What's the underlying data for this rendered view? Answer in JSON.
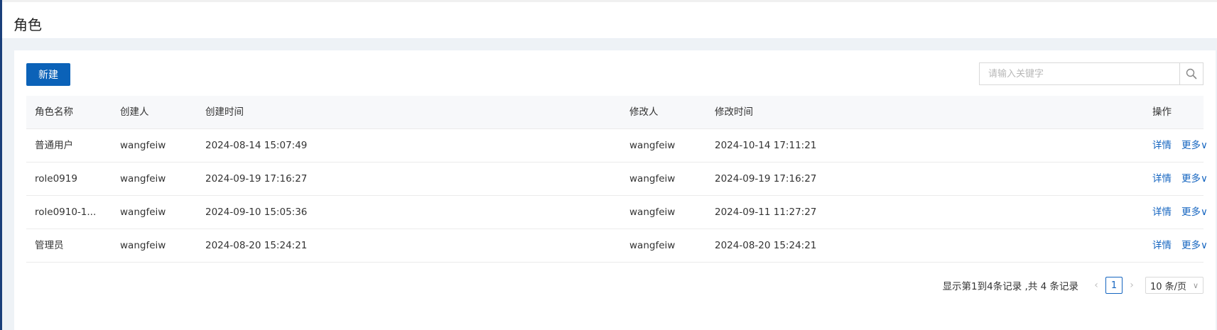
{
  "page": {
    "title": "角色"
  },
  "toolbar": {
    "new_label": "新建"
  },
  "search": {
    "placeholder": "请输入关键字",
    "icon": "search-icon"
  },
  "table": {
    "headers": {
      "name": "角色名称",
      "creator": "创建人",
      "created_at": "创建时间",
      "modifier": "修改人",
      "modified_at": "修改时间",
      "ops": "操作"
    },
    "rows": [
      {
        "name": "普通用户",
        "creator": "wangfeiw",
        "created_at": "2024-08-14 15:07:49",
        "modifier": "wangfeiw",
        "modified_at": "2024-10-14 17:11:21",
        "detail": "详情",
        "more": "更多"
      },
      {
        "name": "role0919",
        "creator": "wangfeiw",
        "created_at": "2024-09-19 17:16:27",
        "modifier": "wangfeiw",
        "modified_at": "2024-09-19 17:16:27",
        "detail": "详情",
        "more": "更多"
      },
      {
        "name": "role0910-1...",
        "creator": "wangfeiw",
        "created_at": "2024-09-10 15:05:36",
        "modifier": "wangfeiw",
        "modified_at": "2024-09-11 11:27:27",
        "detail": "详情",
        "more": "更多"
      },
      {
        "name": "管理员",
        "creator": "wangfeiw",
        "created_at": "2024-08-20 15:24:21",
        "modifier": "wangfeiw",
        "modified_at": "2024-08-20 15:24:21",
        "detail": "详情",
        "more": "更多"
      }
    ]
  },
  "pagination": {
    "summary": "显示第1到4条记录 ,共 4 条记录",
    "current_page": "1",
    "page_size": "10 条/页"
  },
  "colors": {
    "primary": "#0b62b8",
    "link": "#1565c0",
    "background": "#eef2f6"
  }
}
